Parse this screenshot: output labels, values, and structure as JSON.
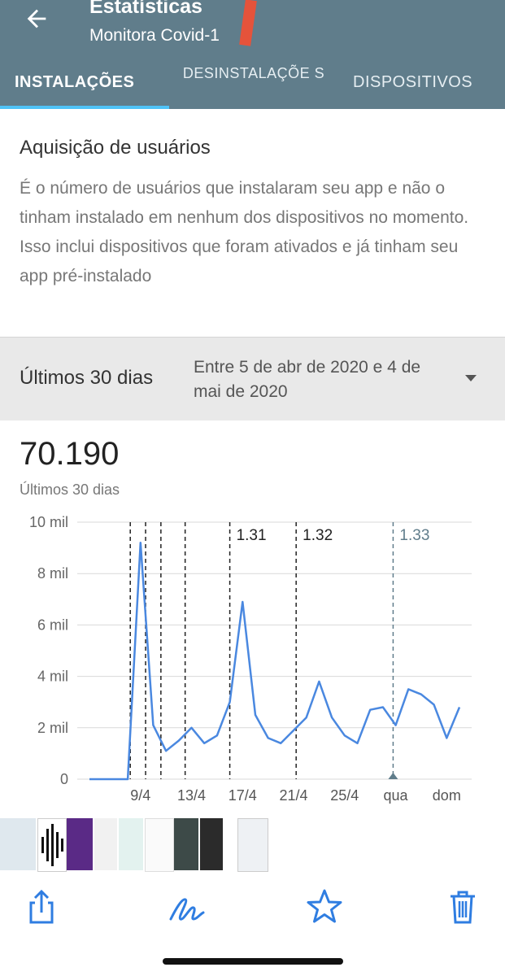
{
  "header": {
    "title": "Estatísticas",
    "subtitle": "Monitora Covid-1",
    "colors": {
      "bar": "#607d8b",
      "indicator": "#4fc3f7"
    }
  },
  "tabs": [
    {
      "label": "INSTALAÇÕES",
      "active": true
    },
    {
      "label": "DESINSTALAÇÕE S",
      "active": false
    },
    {
      "label": "DISPOSITIVOS",
      "active": false
    }
  ],
  "section": {
    "title": "Aquisição de usuários",
    "description": "É o número de usuários que instalaram seu app e não o tinham instalado em nenhum dos dispositivos no momento. Isso inclui dispositivos que foram ativados e já tinham seu app pré-instalado"
  },
  "filter": {
    "period": "Últimos 30 dias",
    "range": "Entre 5 de abr de 2020 e 4 de mai de 2020"
  },
  "summary": {
    "total": "70.190",
    "period": "Últimos 30 dias"
  },
  "chart_data": {
    "type": "line",
    "ylim": [
      0,
      10000
    ],
    "y_ticks": [
      {
        "value": 0,
        "label": "0"
      },
      {
        "value": 2000,
        "label": "2 mil"
      },
      {
        "value": 4000,
        "label": "4 mil"
      },
      {
        "value": 6000,
        "label": "6 mil"
      },
      {
        "value": 8000,
        "label": "8 mil"
      },
      {
        "value": 10000,
        "label": "10 mil"
      }
    ],
    "x_tick_labels": [
      {
        "index": 4,
        "label": "9/4"
      },
      {
        "index": 8,
        "label": "13/4"
      },
      {
        "index": 12,
        "label": "17/4"
      },
      {
        "index": 16,
        "label": "21/4"
      },
      {
        "index": 20,
        "label": "25/4"
      },
      {
        "index": 24,
        "label": "qua"
      },
      {
        "index": 28,
        "label": "dom"
      }
    ],
    "values": [
      0,
      0,
      0,
      0,
      9200,
      2100,
      1100,
      1500,
      2000,
      1400,
      1700,
      3000,
      6900,
      2500,
      1600,
      1400,
      1900,
      2400,
      3800,
      2400,
      1700,
      1400,
      2700,
      2800,
      2100,
      3500,
      3300,
      2900,
      1600,
      2800
    ],
    "annotations": [
      {
        "index": 3.2,
        "label": ""
      },
      {
        "index": 4.4,
        "label": ""
      },
      {
        "index": 5.6,
        "label": ""
      },
      {
        "index": 7.5,
        "label": ""
      },
      {
        "index": 11.0,
        "label": "1.31"
      },
      {
        "index": 16.2,
        "label": "1.32"
      },
      {
        "index": 23.8,
        "label": "1.33",
        "current": true
      }
    ],
    "colors": {
      "line": "#4a88e0",
      "annotation": "#222",
      "current_annotation": "#607d8b"
    },
    "grid": true
  },
  "toolbar": {
    "icons": [
      "share-icon",
      "markup-icon",
      "favorite-icon",
      "trash-icon"
    ],
    "color": "#2f7de1"
  }
}
